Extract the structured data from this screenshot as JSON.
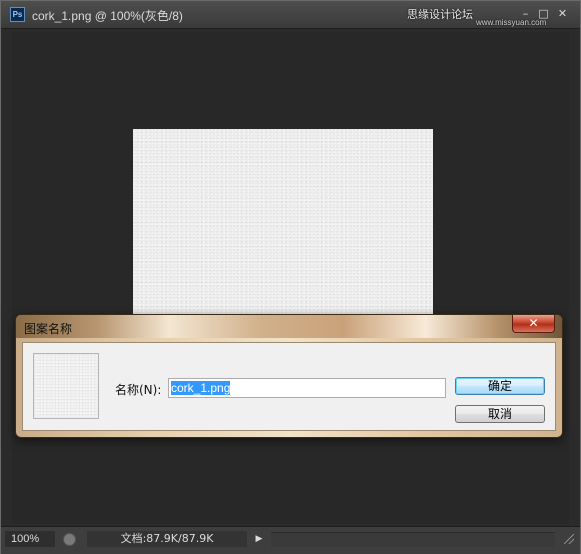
{
  "document_window": {
    "app_icon_text": "Ps",
    "title": "cork_1.png @ 100%(灰色/8)",
    "controls": {
      "minimize": "–",
      "restore": "□",
      "close": "✕"
    },
    "watermark": "思缘设计论坛",
    "watermark_sub": "www.missyuan.com"
  },
  "status_bar": {
    "zoom": "100%",
    "doc_info": "文档:87.9K/87.9K",
    "arrow": "▶"
  },
  "dialog": {
    "title": "图案名称",
    "close": "✕",
    "name_label": "名称(N):",
    "name_value": "cork_1.png",
    "ok_label": "确定",
    "cancel_label": "取消"
  }
}
